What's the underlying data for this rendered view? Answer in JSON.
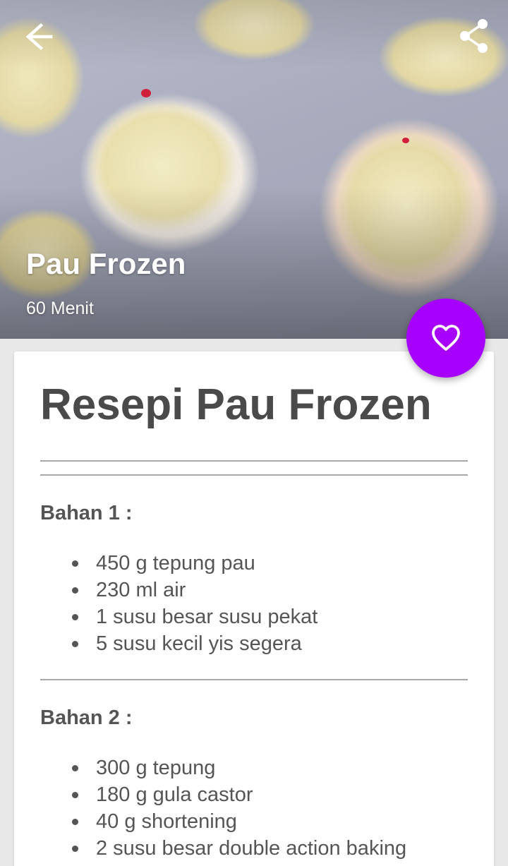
{
  "header": {
    "title": "Pau Frozen",
    "time": "60 Menit"
  },
  "icons": {
    "back": "arrow-back-icon",
    "share": "share-icon",
    "favorite": "heart-outline-icon"
  },
  "colors": {
    "fab": "#a800ff",
    "text": "#555555",
    "title": "#4a4a4a"
  },
  "recipe": {
    "title": "Resepi Pau Frozen",
    "sections": [
      {
        "heading": "Bahan 1 :",
        "items": [
          "450 g tepung pau",
          "230 ml air",
          "1 susu besar susu pekat",
          "5 susu kecil yis segera"
        ]
      },
      {
        "heading": "Bahan 2 :",
        "items": [
          "300 g tepung",
          "180 g gula castor",
          "40 g shortening",
          "2 susu besar double action baking"
        ]
      }
    ]
  }
}
